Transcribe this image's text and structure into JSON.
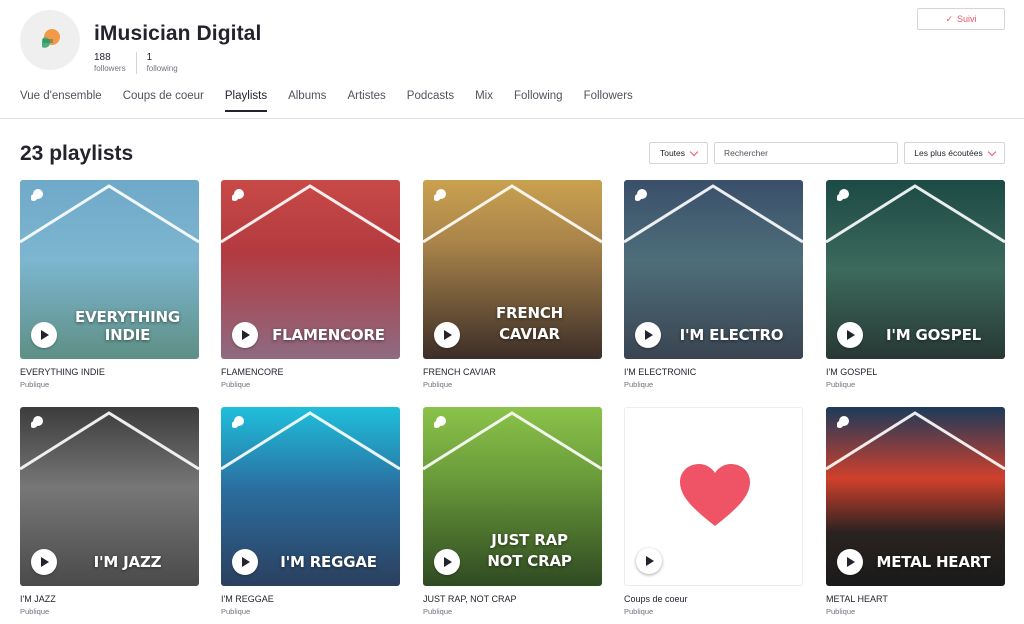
{
  "profile": {
    "name": "iMusician Digital",
    "followers_count": "188",
    "followers_label": "followers",
    "following_count": "1",
    "following_label": "following",
    "follow_button": "Suivi",
    "follow_check_icon": "check-icon"
  },
  "tabs": [
    {
      "label": "Vue d'ensemble",
      "active": false
    },
    {
      "label": "Coups de coeur",
      "active": false
    },
    {
      "label": "Playlists",
      "active": true
    },
    {
      "label": "Albums",
      "active": false
    },
    {
      "label": "Artistes",
      "active": false
    },
    {
      "label": "Podcasts",
      "active": false
    },
    {
      "label": "Mix",
      "active": false
    },
    {
      "label": "Following",
      "active": false
    },
    {
      "label": "Followers",
      "active": false
    }
  ],
  "toolbar": {
    "title": "23 playlists",
    "filter_label": "Toutes",
    "search_placeholder": "Rechercher",
    "sort_label": "Les plus écoutées"
  },
  "colors": {
    "accent": "#ef5466",
    "text": "#23232d",
    "muted": "#72727d",
    "heart": "#ef5466"
  },
  "playlists": [
    {
      "cover_text": "EVERYTHING INDIE",
      "title": "EVERYTHING INDIE",
      "visibility": "Publique"
    },
    {
      "cover_text": "FLAMENCORE",
      "title": "FLAMENCORE",
      "visibility": "Publique"
    },
    {
      "cover_text_1": "FRENCH",
      "cover_text_2": "CAVIAR",
      "title": "FRENCH CAVIAR",
      "visibility": "Publique"
    },
    {
      "cover_text": "I'M ELECTRO",
      "title": "I'M ELECTRONIC",
      "visibility": "Publique"
    },
    {
      "cover_text": "I'M GOSPEL",
      "title": "I'M GOSPEL",
      "visibility": "Publique"
    },
    {
      "cover_text": "I'M JAZZ",
      "title": "I'M JAZZ",
      "visibility": "Publique"
    },
    {
      "cover_text": "I'M REGGAE",
      "title": "I'M REGGAE",
      "visibility": "Publique"
    },
    {
      "cover_text_1": "JUST RAP",
      "cover_text_2": "NOT CRAP",
      "title": "JUST RAP, NOT CRAP",
      "visibility": "Publique"
    },
    {
      "cover_icon": "heart-icon",
      "title": "Coups de coeur",
      "visibility": "Publique"
    },
    {
      "cover_text": "METAL HEART",
      "title": "METAL HEART",
      "visibility": "Publique"
    }
  ]
}
